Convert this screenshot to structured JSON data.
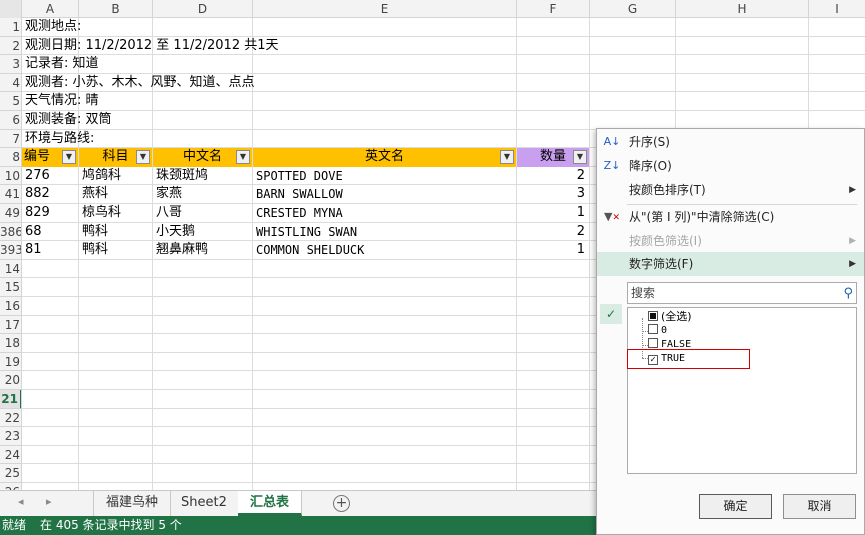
{
  "columns": [
    "A",
    "B",
    "D",
    "E",
    "F",
    "G",
    "H",
    "I"
  ],
  "row_numbers": [
    "1",
    "2",
    "3",
    "4",
    "5",
    "6",
    "7",
    "8",
    "10",
    "41",
    "49",
    "386",
    "393",
    "14",
    "15",
    "16",
    "17",
    "18",
    "19",
    "20",
    "21",
    "22",
    "23",
    "24",
    "25",
    "26"
  ],
  "active_row": "21",
  "info_lines": [
    "观测地点:",
    "观测日期: 11/2/2012 至 11/2/2012 共1天",
    "记录者: 知道",
    "观测者: 小苏、木木、风野、知道、点点",
    "天气情况: 晴",
    "观测装备: 双筒",
    "环境与路线:"
  ],
  "table_headers": [
    "编号",
    "科目",
    "中文名",
    "英文名",
    "数量"
  ],
  "table_rows": [
    {
      "id": "276",
      "family": "鸠鸽科",
      "cn": "珠颈斑鸠",
      "en": "SPOTTED DOVE",
      "qty": "2"
    },
    {
      "id": "882",
      "family": "燕科",
      "cn": "家燕",
      "en": "BARN SWALLOW",
      "qty": "3"
    },
    {
      "id": "829",
      "family": "椋鸟科",
      "cn": "八哥",
      "en": "CRESTED MYNA",
      "qty": "1"
    },
    {
      "id": "68",
      "family": "鸭科",
      "cn": "小天鹅",
      "en": "WHISTLING SWAN",
      "qty": "2"
    },
    {
      "id": "81",
      "family": "鸭科",
      "cn": "翘鼻麻鸭",
      "en": "COMMON SHELDUCK",
      "qty": "1"
    }
  ],
  "sheet_tabs": [
    "福建鸟种",
    "Sheet2",
    "汇总表"
  ],
  "active_tab": "汇总表",
  "status": {
    "ready": "就绪",
    "message": "在 405 条记录中找到 5 个"
  },
  "filter_menu": {
    "sort_asc": "升序(S)",
    "sort_desc": "降序(O)",
    "sort_by_color": "按颜色排序(T)",
    "clear_filter": "从\"(第 I 列)\"中清除筛选(C)",
    "filter_by_color": "按颜色筛选(I)",
    "number_filters": "数字筛选(F)",
    "search_placeholder": "搜索",
    "items": [
      "(全选)",
      "0",
      "FALSE",
      "TRUE"
    ],
    "ok": "确定",
    "cancel": "取消"
  },
  "colors": {
    "accent": "#217346",
    "header_orange": "#ffc000",
    "header_purple": "#c9a0f0",
    "highlight_box": "#d20000"
  }
}
